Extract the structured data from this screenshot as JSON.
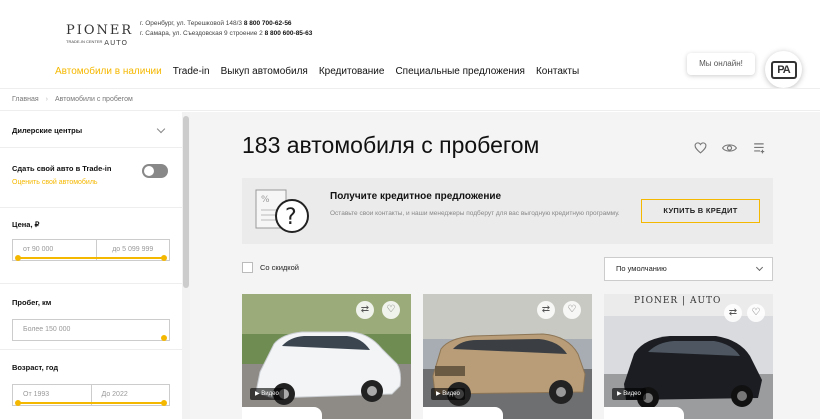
{
  "header": {
    "logo": {
      "brand": "PIONER",
      "sub_left": "TRADE-IN CENTER",
      "sub_right": "AUTO"
    },
    "address_1": {
      "text": "г. Оренбург, ул. Терешковой 148/3 ",
      "phone": "8 800 700-62-56"
    },
    "address_2": {
      "text": "г. Самара, ул. Съездовская 9 строение 2 ",
      "phone": "8 800 600-85-63"
    },
    "nav": [
      {
        "label": "Автомобили в наличии",
        "active": true
      },
      {
        "label": "Trade-in"
      },
      {
        "label": "Выкуп автомобиля"
      },
      {
        "label": "Кредитование"
      },
      {
        "label": "Специальные предложения"
      },
      {
        "label": "Контакты"
      }
    ],
    "online_label": "Мы онлайн!",
    "online_logo": "PA"
  },
  "breadcrumb": {
    "home": "Главная",
    "separator": "›",
    "current": "Автомобили с пробегом"
  },
  "sidebar": {
    "dealers": {
      "title": "Дилерские центры"
    },
    "tradein": {
      "title": "Сдать свой авто в Trade-in",
      "link": "Оценить свой автомобиль",
      "toggle_on": false
    },
    "price": {
      "title": "Цена, ₽",
      "from_placeholder": "от 90 000",
      "to_placeholder": "до 5 099 999"
    },
    "mileage": {
      "title": "Пробег, км",
      "placeholder": "Более 150 000"
    },
    "age": {
      "title": "Возраст, год",
      "from_placeholder": "От 1993",
      "to_placeholder": "До 2022"
    }
  },
  "main": {
    "title": "183 автомобиля с пробегом",
    "tools": {
      "favorite_icon": "heart-icon",
      "views_icon": "eye-icon",
      "compare_icon": "compare-list-icon"
    },
    "promo": {
      "title": "Получите кредитное предложение",
      "text": "Оставьте свои контакты, и наши менеджеры подберут для вас выгодную кредитную программу.",
      "button": "КУПИТЬ В КРЕДИТ"
    },
    "discount_label": "Со скидкой",
    "sort_value": "По умолчанию",
    "cards": [
      {
        "video_label": "Видео",
        "color": "#f2f4f6"
      },
      {
        "video_label": "Видео",
        "color": "#b89d78"
      },
      {
        "video_label": "Видео",
        "color": "#1b1d22",
        "banner": "PIONER | AUTO"
      }
    ]
  },
  "colors": {
    "accent": "#f5b800"
  }
}
